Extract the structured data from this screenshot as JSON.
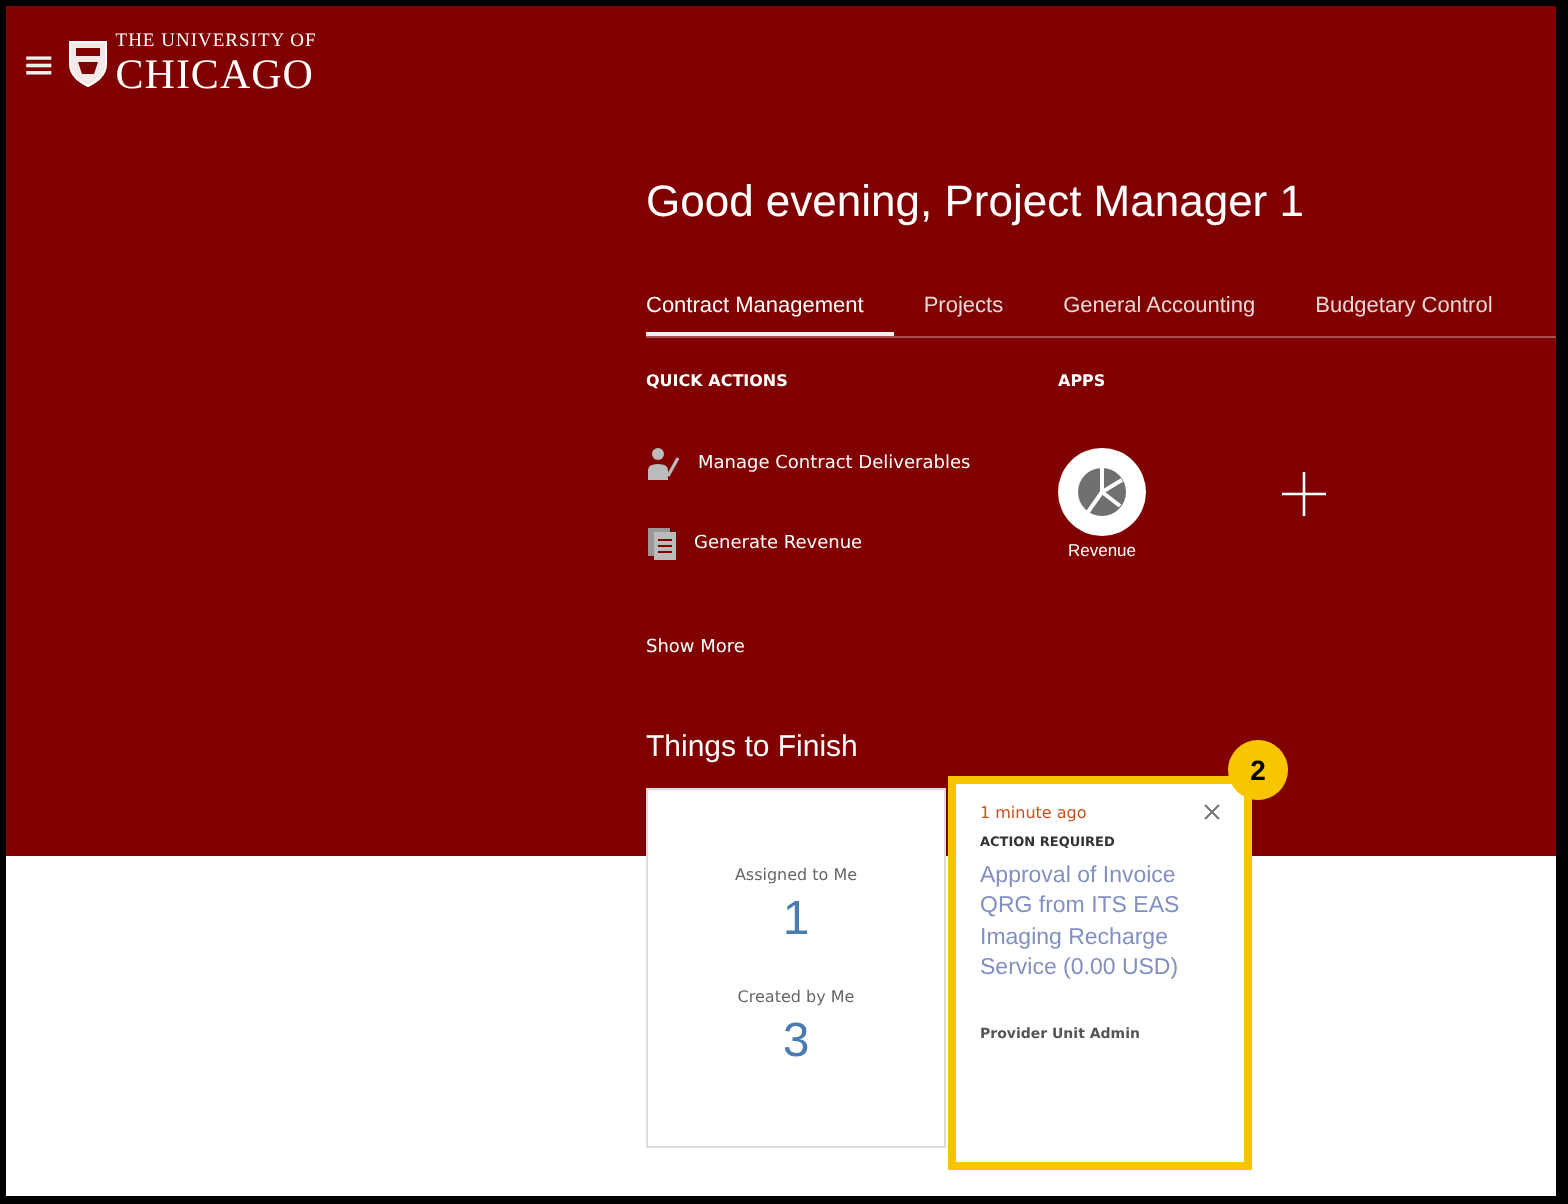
{
  "header": {
    "menu_icon": "≡",
    "logo_top": "THE UNIVERSITY OF",
    "logo_bottom": "CHICAGO"
  },
  "greeting": "Good evening, Project Manager 1",
  "tabs": [
    {
      "label": "Contract Management",
      "selected": true
    },
    {
      "label": "Projects",
      "selected": false
    },
    {
      "label": "General Accounting",
      "selected": false
    },
    {
      "label": "Budgetary Control",
      "selected": false
    }
  ],
  "quick_actions": {
    "title": "QUICK ACTIONS",
    "items": [
      {
        "label": "Manage Contract Deliverables",
        "kind": "person"
      },
      {
        "label": "Generate Revenue",
        "kind": "document"
      }
    ],
    "show_more": "Show More"
  },
  "apps": {
    "title": "APPS",
    "items": [
      {
        "label": "Revenue"
      }
    ]
  },
  "things_to_finish": {
    "title": "Things to Finish",
    "counts": [
      {
        "label": "Assigned to Me",
        "value": "1"
      },
      {
        "label": "Created by Me",
        "value": "3"
      }
    ],
    "notification": {
      "time": "1 minute ago",
      "type": "ACTION REQUIRED",
      "title": "Approval of Invoice QRG from ITS EAS Imaging Recharge Service (0.00 USD)",
      "from": "Provider Unit Admin",
      "callout_badge": "2"
    }
  }
}
